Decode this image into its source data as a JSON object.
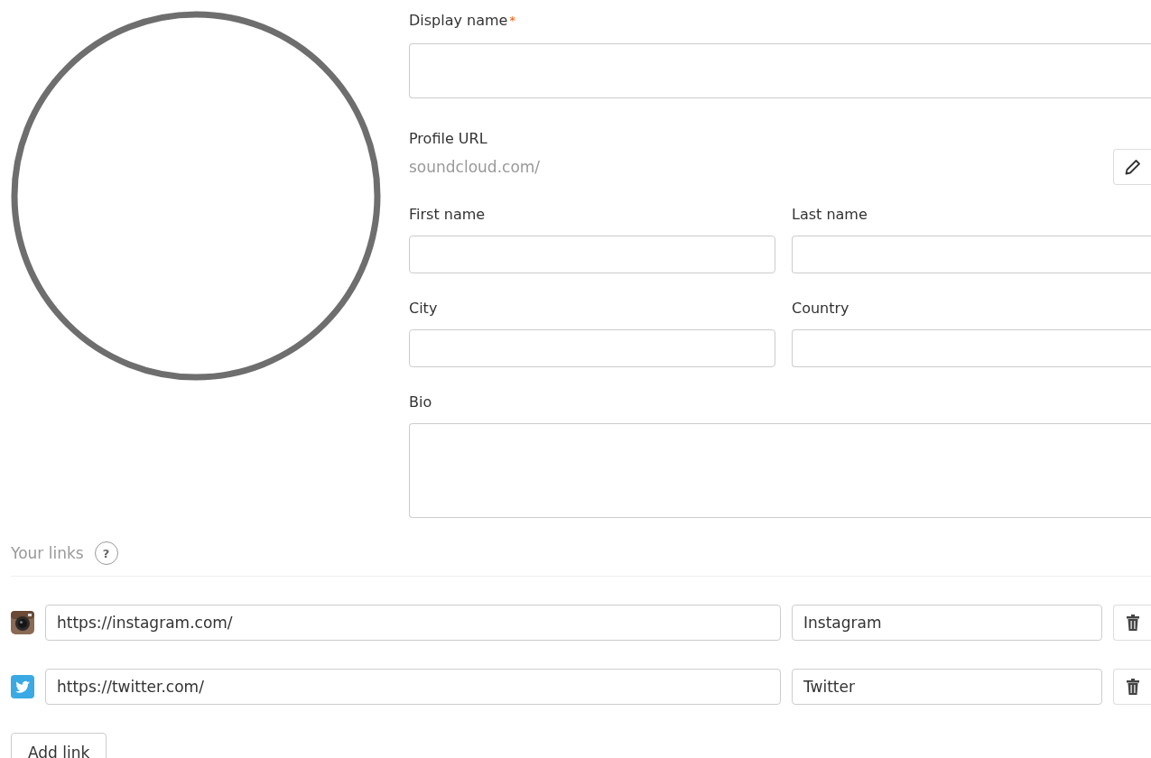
{
  "display_name": {
    "label": "Display name",
    "required_mark": "*"
  },
  "profile_url": {
    "label": "Profile URL",
    "prefix": "soundcloud.com/"
  },
  "name_fields": [
    {
      "label": "First name"
    },
    {
      "label": "Last name"
    }
  ],
  "location_fields": [
    {
      "label": "City"
    },
    {
      "label": "Country"
    }
  ],
  "bio": {
    "label": "Bio"
  },
  "links": {
    "title": "Your links",
    "help": "?",
    "items": [
      {
        "kind": "instagram",
        "url": "https://instagram.com/",
        "title": "Instagram"
      },
      {
        "kind": "twitter",
        "url": "https://twitter.com/",
        "title": "Twitter"
      }
    ],
    "add_button": "Add link"
  }
}
